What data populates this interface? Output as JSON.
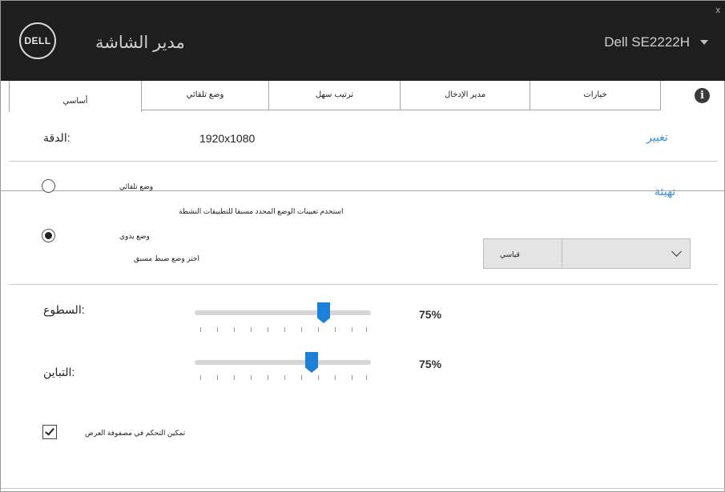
{
  "titlebar": {
    "logo_text": "DELL",
    "app_title": "مدير الشاشة",
    "monitor_name": "Dell SE2222H",
    "close_label": "x"
  },
  "tabs": [
    {
      "label": "أساسي",
      "active": true
    },
    {
      "label": "وضع تلقائي",
      "active": false
    },
    {
      "label": "ترتيب سهل",
      "active": false
    },
    {
      "label": "مدير الإدخال",
      "active": false
    },
    {
      "label": "خيارات",
      "active": false
    }
  ],
  "info_icon": "i",
  "resolution": {
    "label": ":الدقة",
    "value": "1920x1080",
    "change_link": "تغيير"
  },
  "mode": {
    "configure_link": "تهيئة",
    "auto_label": "وضع تلقائي",
    "auto_selected": false,
    "auto_description": "استخدم تعيينات الوضع المحدد مسبقا للتطبيقات النشطة",
    "manual_label": "وضع يدوي",
    "manual_selected": true,
    "manual_description": "اختر وضع ضبط مسبق",
    "preset_value": "قياسي"
  },
  "brightness": {
    "label": ":السطوع",
    "value_text": "75%",
    "value": 0.75
  },
  "contrast": {
    "label": ":التباين",
    "value_text": "75%",
    "value": 0.75
  },
  "matrix_control": {
    "label": "تمكين التحكم في مصفوفة العرض",
    "checked": true
  },
  "colors": {
    "titlebar_bg": "#1e1e1e",
    "accent": "#1c7fd8",
    "link": "#3a8fd6"
  }
}
